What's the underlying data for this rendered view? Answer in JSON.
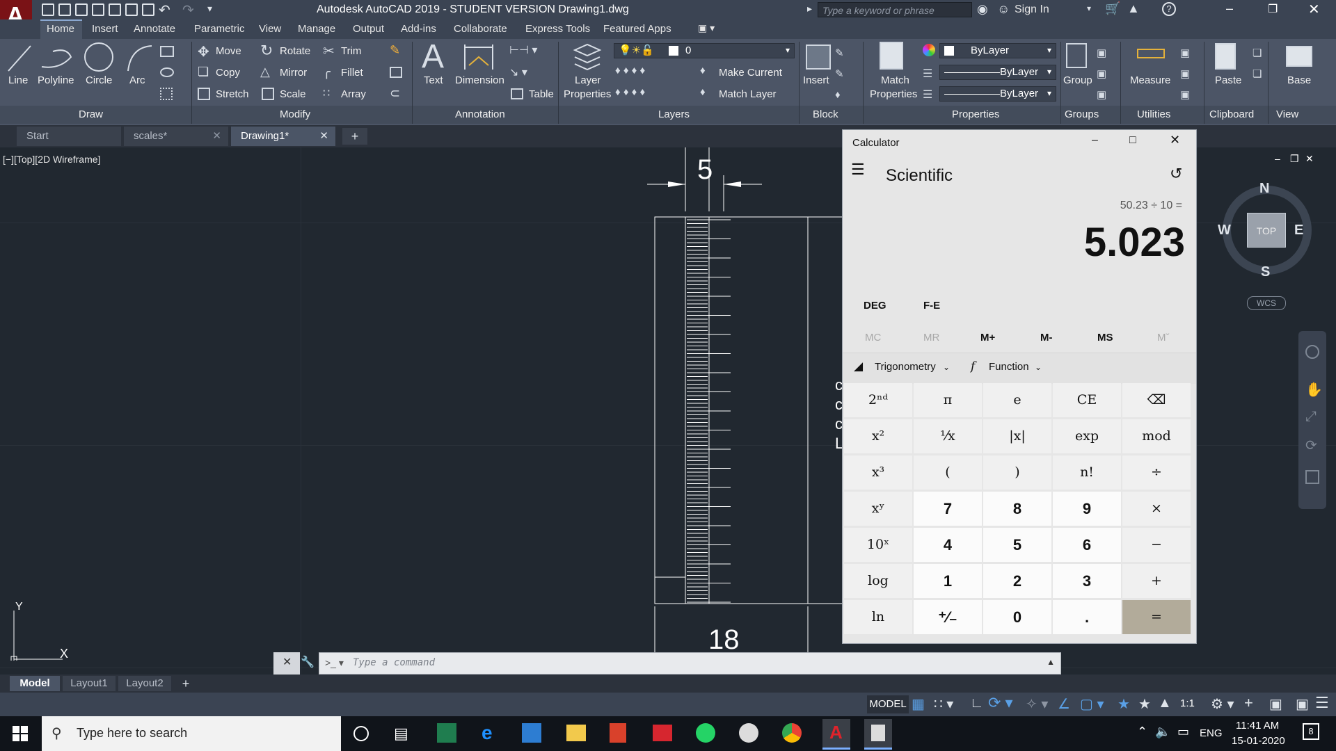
{
  "title_bar": {
    "title": "Autodesk AutoCAD 2019 - STUDENT VERSION    Drawing1.dwg",
    "search_placeholder": "Type a keyword or phrase",
    "sign_in": "Sign In"
  },
  "menu_tabs": [
    "Home",
    "Insert",
    "Annotate",
    "Parametric",
    "View",
    "Manage",
    "Output",
    "Add-ins",
    "Collaborate",
    "Express Tools",
    "Featured Apps"
  ],
  "ribbon": {
    "draw": {
      "line": "Line",
      "polyline": "Polyline",
      "circle": "Circle",
      "arc": "Arc",
      "panel": "Draw"
    },
    "modify": {
      "move": "Move",
      "rotate": "Rotate",
      "trim": "Trim",
      "copy": "Copy",
      "mirror": "Mirror",
      "fillet": "Fillet",
      "stretch": "Stretch",
      "scale": "Scale",
      "array": "Array",
      "panel": "Modify"
    },
    "annotation": {
      "text": "Text",
      "dimension": "Dimension",
      "table": "Table",
      "panel": "Annotation"
    },
    "layers": {
      "layer_properties_1": "Layer",
      "layer_properties_2": "Properties",
      "layer_value": "0",
      "make_current": "Make Current",
      "match_layer": "Match Layer",
      "panel": "Layers"
    },
    "block": {
      "insert": "Insert",
      "panel": "Block"
    },
    "properties": {
      "match_1": "Match",
      "match_2": "Properties",
      "bylayer_color": "ByLayer",
      "bylayer_lw": "ByLayer",
      "bylayer_lt": "ByLayer",
      "panel": "Properties"
    },
    "groups": {
      "group": "Group",
      "panel": "Groups"
    },
    "utilities": {
      "measure": "Measure",
      "panel": "Utilities"
    },
    "clipboard": {
      "paste": "Paste",
      "panel": "Clipboard"
    },
    "view": {
      "base": "Base",
      "panel": "View"
    }
  },
  "file_tabs": [
    "Start",
    "scales*",
    "Drawing1*"
  ],
  "viewport_label": "[−][Top][2D Wireframe]",
  "drawing": {
    "dim_top": "5",
    "dim_bottom": "18"
  },
  "viewcube": {
    "n": "N",
    "s": "S",
    "e": "E",
    "w": "W",
    "top": "TOP",
    "wcs": "WCS"
  },
  "ucs": {
    "x": "X",
    "y": "Y"
  },
  "command_placeholder": "Type a command",
  "layout_tabs": [
    "Model",
    "Layout1",
    "Layout2"
  ],
  "status_bar": {
    "model": "MODEL",
    "scale": "1:1"
  },
  "calculator": {
    "window_title": "Calculator",
    "mode": "Scientific",
    "expression": "50.23 ÷ 10 =",
    "display": "5.023",
    "deg": "DEG",
    "fe": "F-E",
    "memory": [
      "MC",
      "MR",
      "M+",
      "M-",
      "MS",
      "Mˇ"
    ],
    "trig": "Trigonometry",
    "func": "Function",
    "keys": [
      [
        "2ⁿᵈ",
        "π",
        "e",
        "CE",
        "⌫"
      ],
      [
        "x²",
        "¹⁄x",
        "|x|",
        "exp",
        "mod"
      ],
      [
        "x³",
        "(",
        ")",
        "n!",
        "÷"
      ],
      [
        "xʸ",
        "7",
        "8",
        "9",
        "×"
      ],
      [
        "10ˣ",
        "4",
        "5",
        "6",
        "−"
      ],
      [
        "log",
        "1",
        "2",
        "3",
        "+"
      ],
      [
        "ln",
        "⁺⁄₋",
        "0",
        ".",
        "="
      ]
    ]
  },
  "taskbar": {
    "search": "Type here to search",
    "lang": "ENG",
    "time": "11:41 AM",
    "date": "15-01-2020",
    "notif": "8"
  }
}
